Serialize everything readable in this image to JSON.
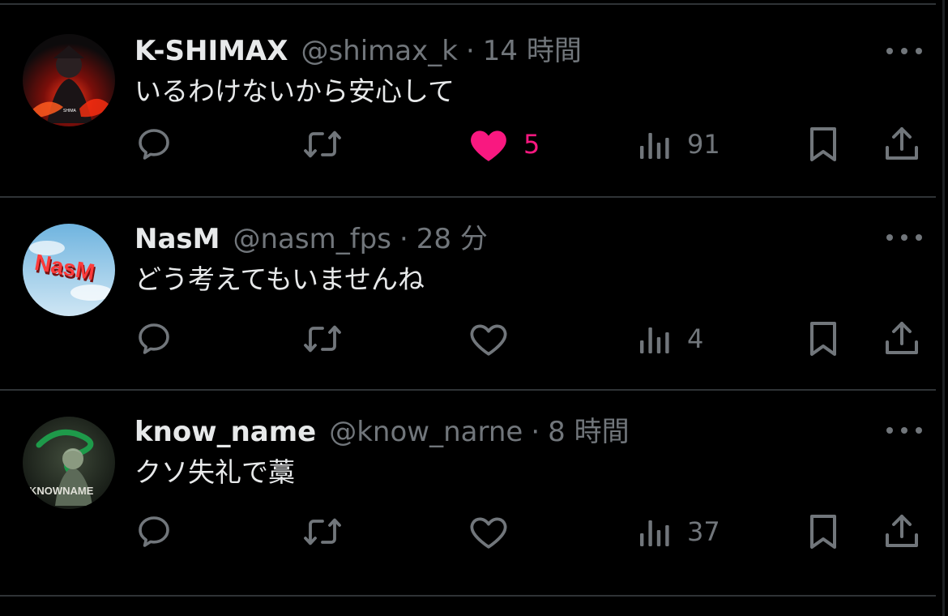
{
  "theme": {
    "background": "#000000",
    "text": "#e7e9ea",
    "muted": "#71767b",
    "divider": "#2f3336",
    "like": "#f91880"
  },
  "tweets": [
    {
      "name": "K-SHIMAX",
      "handle": "@shimax_k",
      "separator": "·",
      "time": "14 時間",
      "text": "いるわけないから安心して",
      "avatar_label": "SHIMA",
      "likes": "5",
      "liked": true,
      "views": "91"
    },
    {
      "name": "NasM",
      "handle": "@nasm_fps",
      "separator": "·",
      "time": "28 分",
      "text": "どう考えてもいませんね",
      "avatar_label": "NasM",
      "likes": "",
      "liked": false,
      "views": "4"
    },
    {
      "name": "know_name",
      "handle": "@know_narne",
      "separator": "·",
      "time": "8 時間",
      "text": "クソ失礼で藁",
      "avatar_label": "KNOWNAME",
      "likes": "",
      "liked": false,
      "views": "37"
    }
  ],
  "icons": {
    "reply": "reply-bubble-icon",
    "retweet": "retweet-arrows-icon",
    "like": "heart-icon",
    "views": "bar-chart-icon",
    "bookmark": "bookmark-icon",
    "share": "share-upload-icon",
    "more": "more-dots-icon"
  }
}
